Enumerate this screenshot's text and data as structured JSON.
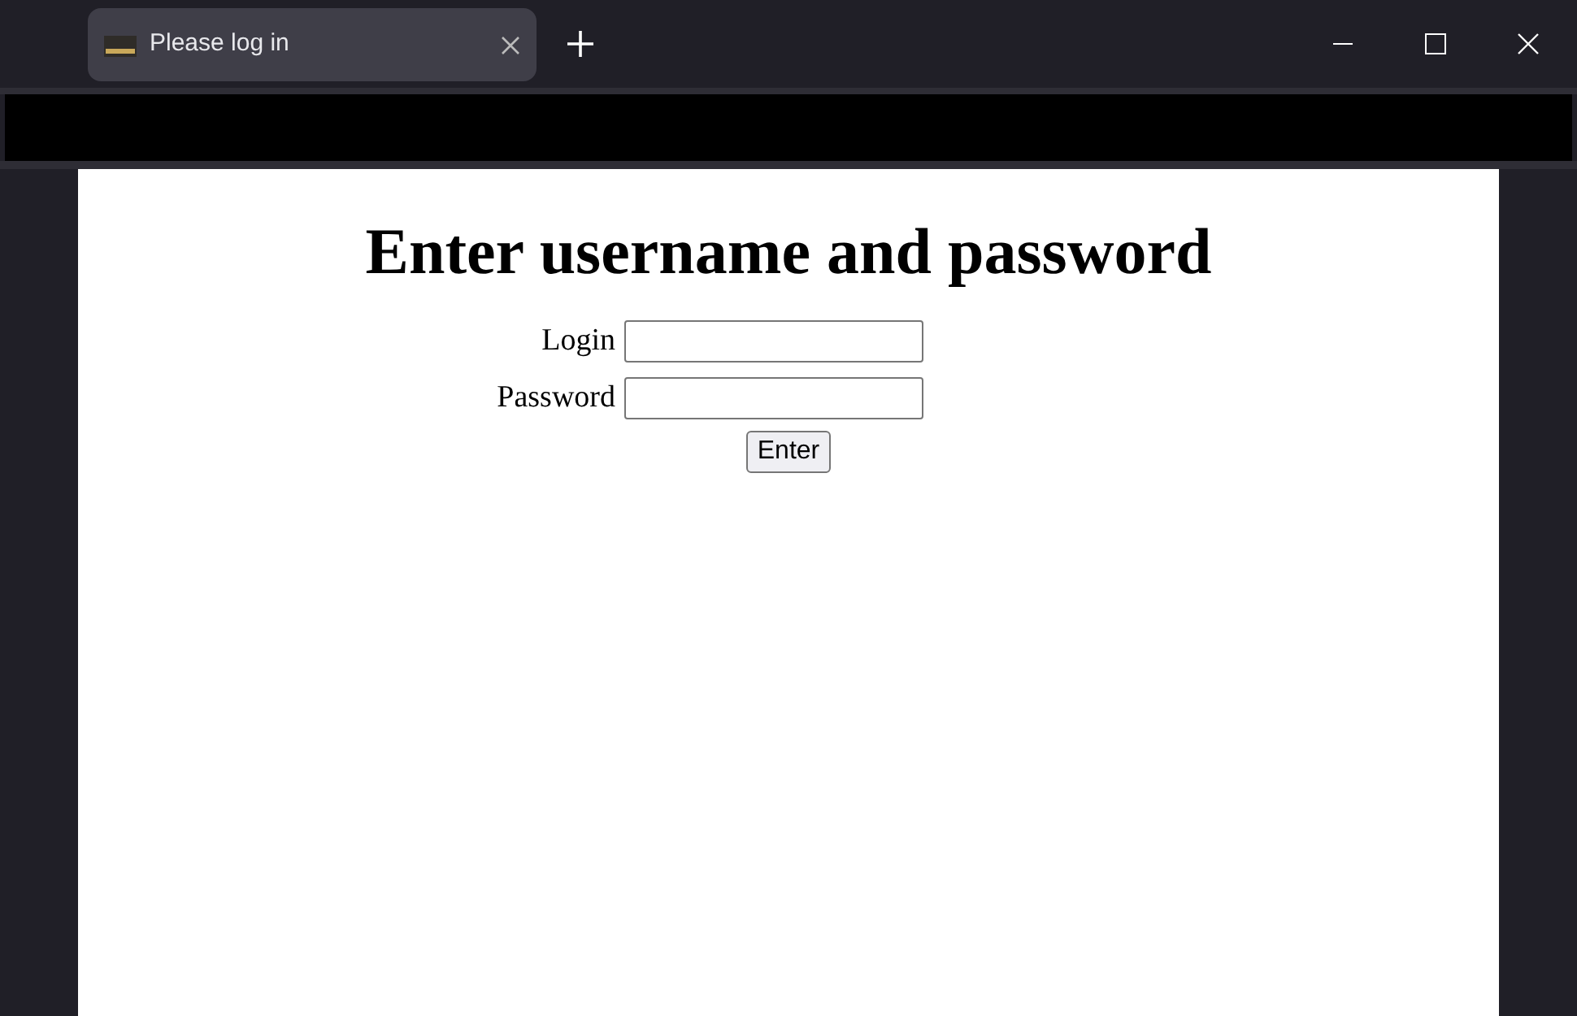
{
  "tab": {
    "title": "Please log in"
  },
  "page": {
    "heading": "Enter username and password",
    "fields": [
      {
        "label": "Login"
      },
      {
        "label": "Password"
      }
    ],
    "button": "Enter"
  }
}
